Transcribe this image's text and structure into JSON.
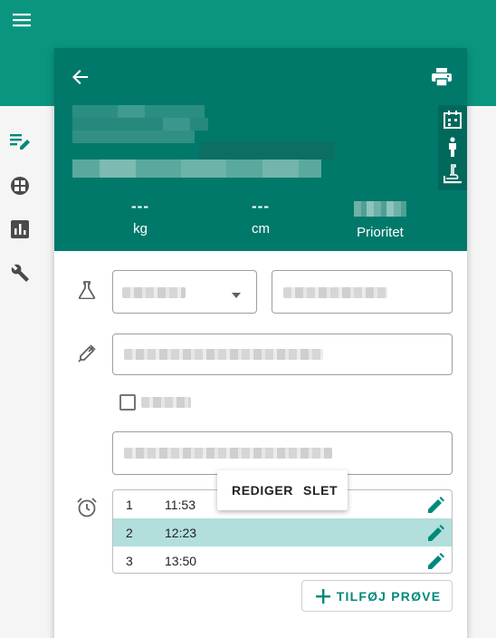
{
  "colors": {
    "appbar": "#0a9580",
    "header": "#00796b",
    "accent": "#00897b",
    "selected_row": "#b2dfdb"
  },
  "appbar": {
    "menu_icon": "menu-icon"
  },
  "sidebar": {
    "items": [
      {
        "icon": "edit-note-icon"
      },
      {
        "icon": "calculator-icon"
      },
      {
        "icon": "bar-chart-icon"
      },
      {
        "icon": "wrench-icon"
      }
    ]
  },
  "header": {
    "back_icon": "arrow-back-icon",
    "print_icon": "print-icon",
    "stats": [
      {
        "value": "---",
        "label": "kg"
      },
      {
        "value": "---",
        "label": "cm"
      },
      {
        "value": "",
        "label": "Prioritet"
      }
    ]
  },
  "times": {
    "rows": [
      {
        "num": "1",
        "time": "11:53"
      },
      {
        "num": "2",
        "time": "12:23"
      },
      {
        "num": "3",
        "time": "13:50"
      }
    ]
  },
  "context_menu": {
    "edit_label": "REDIGER",
    "delete_label": "SLET"
  },
  "add_button": {
    "label": "TILFØJ PRØVE"
  }
}
